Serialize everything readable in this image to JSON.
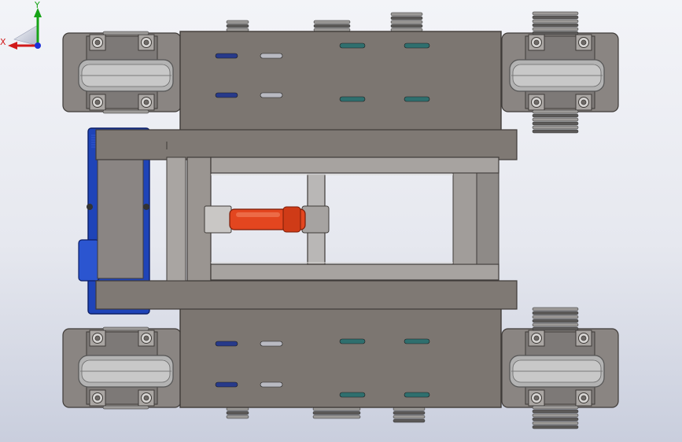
{
  "view": {
    "triad": {
      "x_label": "X",
      "y_label": "Y"
    }
  },
  "colors": {
    "background_top": "#f3f4f8",
    "background_bottom": "#c9cedd",
    "frame_plate": "#7c7671",
    "frame_edge": "#3f3b38",
    "wheel_housing": "#8a8582",
    "wheel": "#b3b3b3",
    "motor": "#1f44b8",
    "cylinder": "#e3461f",
    "slot_teal": "#2f6f6e",
    "slot_blue": "#273a8a",
    "triad_x": "#d11a1a",
    "triad_y": "#17a317",
    "triad_z": "#1b2fd8"
  },
  "model": {
    "components": [
      "chassis-frame-top",
      "chassis-frame-bottom",
      "wheel-assembly-top-left",
      "wheel-assembly-top-right",
      "wheel-assembly-bottom-left",
      "wheel-assembly-bottom-right",
      "drive-motor",
      "hydraulic-cylinder",
      "guide-column"
    ]
  }
}
